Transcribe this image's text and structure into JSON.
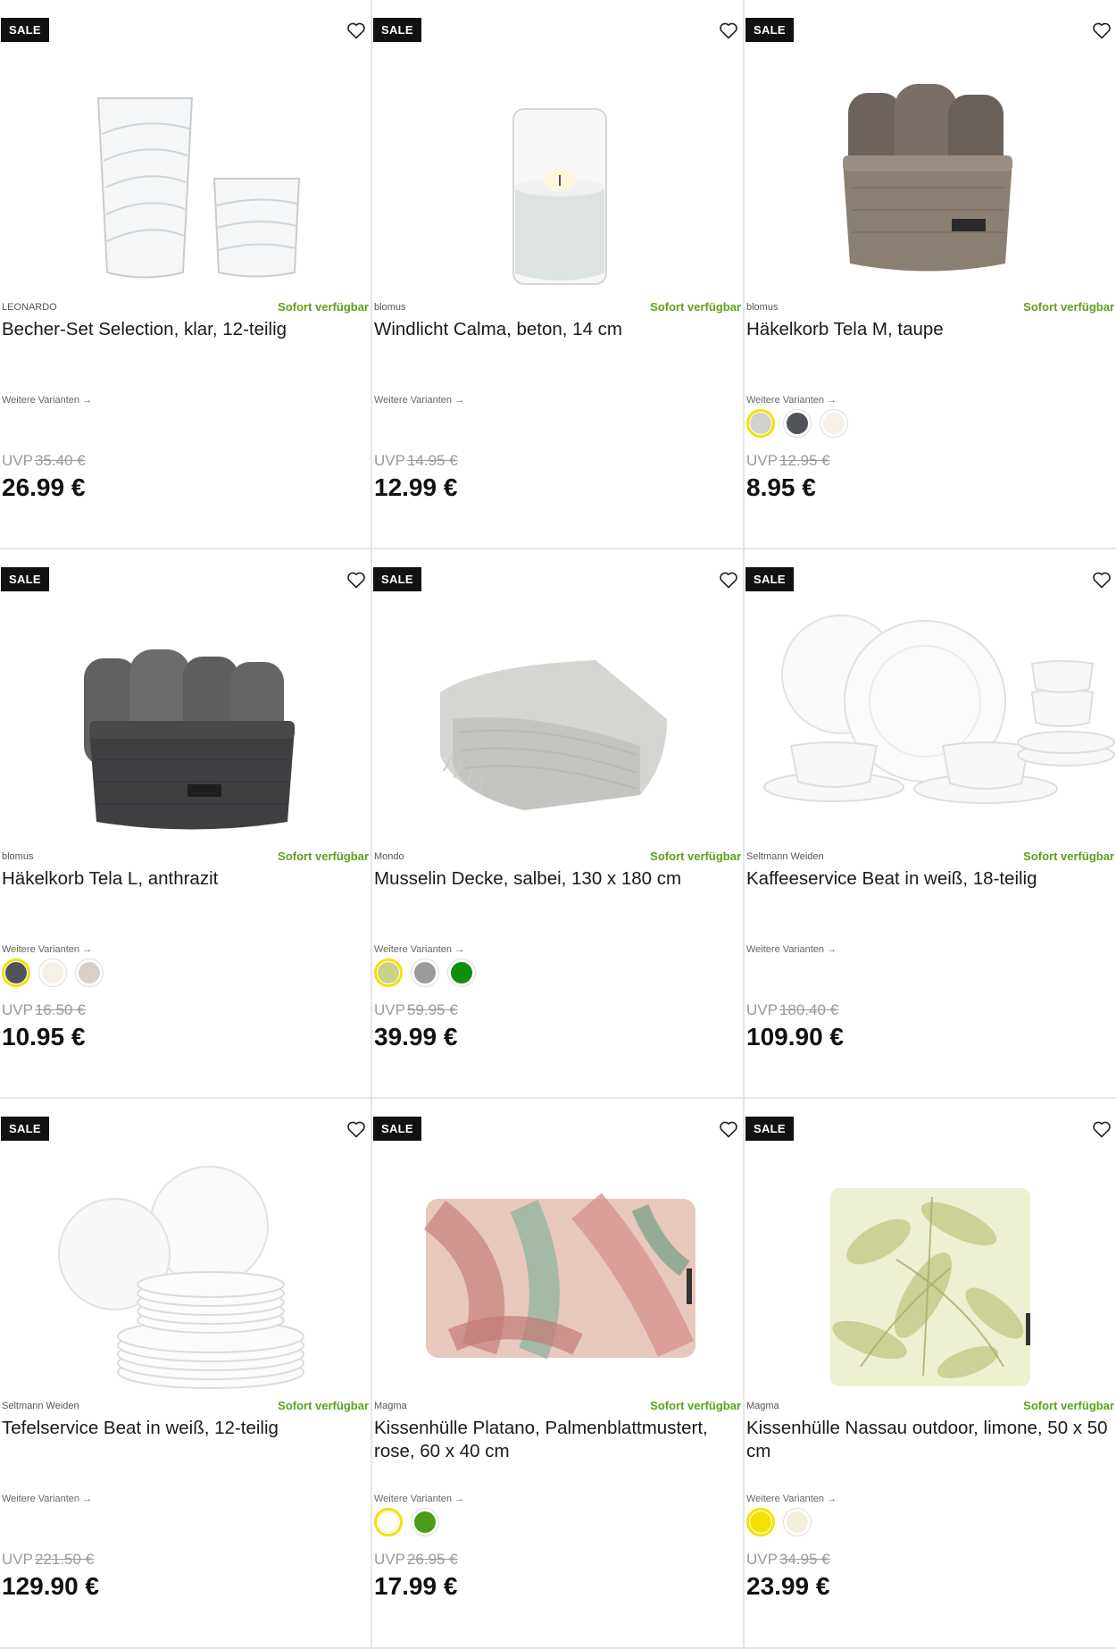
{
  "products": [
    {
      "sale": "SALE",
      "brand": "LEONARDO",
      "availability": "Sofort verfügbar",
      "title": "Becher-Set Selection, klar, 12-teilig",
      "variants": "Weitere Varianten →",
      "uvp_label": "UVP",
      "uvp": "35.40 €",
      "price": "26.99 €",
      "swatches": []
    },
    {
      "sale": "SALE",
      "brand": "blomus",
      "availability": "Sofort verfügbar",
      "title": "Windlicht Calma, beton, 14 cm",
      "variants": "Weitere Varianten →",
      "uvp_label": "UVP",
      "uvp": "14.95 €",
      "price": "12.99 €",
      "swatches": []
    },
    {
      "sale": "SALE",
      "brand": "blomus",
      "availability": "Sofort verfügbar",
      "title": "Häkelkorb Tela M, taupe",
      "variants": "Weitere Varianten →",
      "uvp_label": "UVP",
      "uvp": "12.95 €",
      "price": "8.95 €",
      "swatches": [
        {
          "color": "#d2d0cc",
          "selected": true
        },
        {
          "color": "#505358",
          "selected": false
        },
        {
          "color": "#f6f0e6",
          "selected": false
        }
      ]
    },
    {
      "sale": "SALE",
      "brand": "blomus",
      "availability": "Sofort verfügbar",
      "title": "Häkelkorb Tela L, anthrazit",
      "variants": "Weitere Varianten →",
      "uvp_label": "UVP",
      "uvp": "16.50 €",
      "price": "10.95 €",
      "swatches": [
        {
          "color": "#505358",
          "selected": true
        },
        {
          "color": "#f6f0e6",
          "selected": false
        },
        {
          "color": "#d8cfc9",
          "selected": false
        }
      ]
    },
    {
      "sale": "SALE",
      "brand": "Mondo",
      "availability": "Sofort verfügbar",
      "title": "Musselin Decke, salbei, 130 x 180 cm",
      "variants": "Weitere Varianten →",
      "uvp_label": "UVP",
      "uvp": "59.95 €",
      "price": "39.99 €",
      "swatches": [
        {
          "color": "#c9d187",
          "selected": true
        },
        {
          "color": "#9b9b9b",
          "selected": false
        },
        {
          "color": "#0d8f0d",
          "selected": false
        }
      ]
    },
    {
      "sale": "SALE",
      "brand": "Seltmann Weiden",
      "availability": "Sofort verfügbar",
      "title": "Kaffeeservice Beat in weiß, 18-teilig",
      "variants": "Weitere Varianten →",
      "uvp_label": "UVP",
      "uvp": "180.40 €",
      "price": "109.90 €",
      "swatches": []
    },
    {
      "sale": "SALE",
      "brand": "Seltmann Weiden",
      "availability": "Sofort verfügbar",
      "title": "Tefelservice Beat in weiß, 12-teilig",
      "variants": "Weitere Varianten →",
      "uvp_label": "UVP",
      "uvp": "221.50 €",
      "price": "129.90 €",
      "swatches": []
    },
    {
      "sale": "SALE",
      "brand": "Magma",
      "availability": "Sofort verfügbar",
      "title": "Kissenhülle Platano, Palmenblattmustert, rose, 60 x 40 cm",
      "variants": "Weitere Varianten →",
      "uvp_label": "UVP",
      "uvp": "26.95 €",
      "price": "17.99 €",
      "swatches": [
        {
          "color": "#ffffff",
          "selected": true
        },
        {
          "color": "#4c9a1a",
          "selected": false
        }
      ]
    },
    {
      "sale": "SALE",
      "brand": "Magma",
      "availability": "Sofort verfügbar",
      "title": "Kissenhülle Nassau outdoor, limone, 50 x 50 cm",
      "variants": "Weitere Varianten →",
      "uvp_label": "UVP",
      "uvp": "34.95 €",
      "price": "23.99 €",
      "swatches": [
        {
          "color": "#f4e100",
          "selected": true
        },
        {
          "color": "#f4efdc",
          "selected": false
        }
      ]
    }
  ],
  "images": [
    "glass-tumblers-image",
    "candle-holder-image",
    "crochet-basket-taupe-image",
    "crochet-basket-anthracite-image",
    "muslin-blanket-image",
    "coffee-service-image",
    "dinner-service-image",
    "palm-cushion-image",
    "leaf-cushion-image"
  ],
  "colors": {
    "accent_green": "#5ba21b",
    "swatch_selected": "#f2e200",
    "sale_bg": "#111111"
  }
}
